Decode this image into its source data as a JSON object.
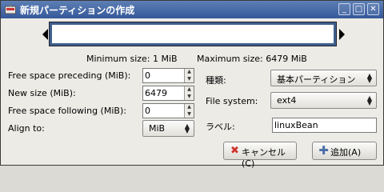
{
  "window": {
    "title": "新規パーティションの作成",
    "minimize_glyph": "_",
    "maximize_glyph": "□",
    "close_glyph": "✕"
  },
  "partition_bar": {
    "min_label": "Minimum size: 1 MiB",
    "max_label": "Maximum size: 6479 MiB"
  },
  "form": {
    "free_before": {
      "label": "Free space preceding (MiB):",
      "value": "0"
    },
    "new_size": {
      "label": "New size (MiB):",
      "value": "6479"
    },
    "free_after": {
      "label": "Free space following (MiB):",
      "value": "0"
    },
    "align": {
      "label": "Align to:",
      "value": "MiB"
    },
    "type": {
      "label": "種類:",
      "value": "基本パーティション"
    },
    "filesystem": {
      "label": "File system:",
      "value": "ext4"
    },
    "fs_label": {
      "label": "ラベル:",
      "value": "linuxBean"
    }
  },
  "buttons": {
    "cancel": "キャンセル(C)",
    "add": "追加(A)"
  },
  "icons": {
    "app": "app-icon",
    "cancel": "cancel-icon",
    "add": "add-icon"
  },
  "colors": {
    "titlebar": "#4a6ea8",
    "partition_bar": "#3f5f8d",
    "cancel_icon": "#d0342c",
    "add_icon": "#4a6ea8"
  }
}
